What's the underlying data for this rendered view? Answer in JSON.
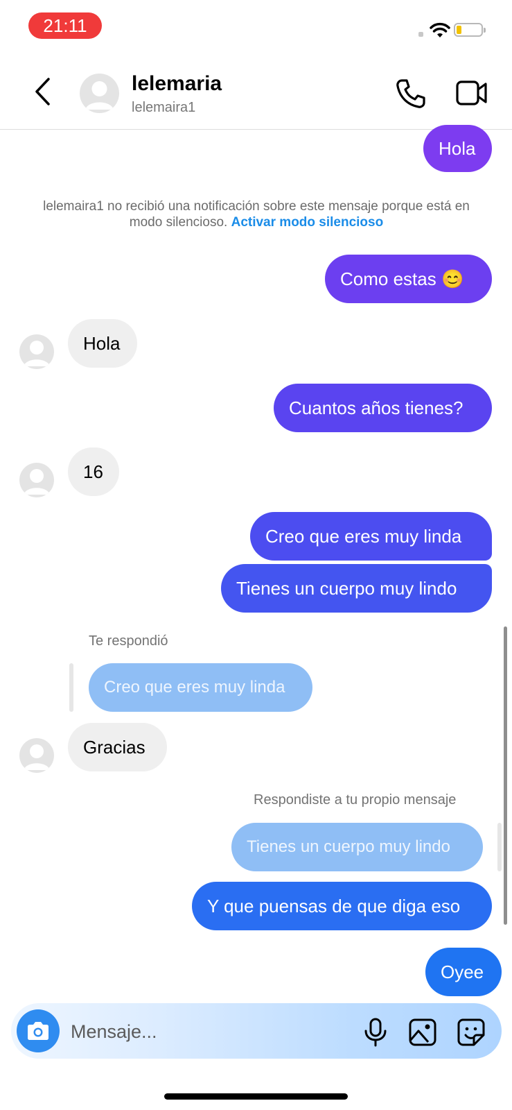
{
  "status_bar": {
    "time": "21:11",
    "time_pill_color": "#f03a3a",
    "battery_color": "#f2c200"
  },
  "header": {
    "name": "lelemaria",
    "username": "lelemaira1"
  },
  "notice": {
    "text": "lelemaira1 no recibió una notificación sobre este mensaje porque está en modo silencioso.",
    "link": "Activar modo silencioso"
  },
  "messages": [
    {
      "from": "me",
      "text": "Hola"
    },
    {
      "from": "me",
      "text": "Como estas 😊"
    },
    {
      "from": "them",
      "text": "Hola"
    },
    {
      "from": "me",
      "text": "Cuantos años tienes?"
    },
    {
      "from": "them",
      "text": "16"
    },
    {
      "from": "me",
      "text": "Creo que eres muy linda"
    },
    {
      "from": "me",
      "text": "Tienes un cuerpo muy lindo"
    },
    {
      "from": "them",
      "text": "Gracias",
      "reply_label": "Te respondió",
      "quoted": "Creo que eres muy linda"
    },
    {
      "from": "me",
      "text": "Y que puensas de que diga eso",
      "reply_label": "Respondiste a tu propio mensaje",
      "quoted": "Tienes un cuerpo muy lindo"
    },
    {
      "from": "me",
      "text": "Oyee"
    }
  ],
  "composer": {
    "placeholder": "Mensaje..."
  },
  "colors": {
    "bubble_purple": "#7d3cf0",
    "bubble_blue": "#3a6ff0",
    "bubble_bright_blue": "#1f74f2",
    "quoted_bubble": "#8fbef5",
    "link_blue": "#1a8ce8",
    "incoming_bubble": "#efefef"
  }
}
